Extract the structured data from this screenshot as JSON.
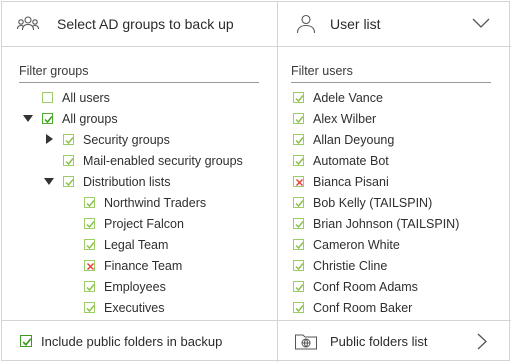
{
  "header": {
    "groups_title": "Select AD groups to back up",
    "users_title": "User list",
    "groups_icon": "group-people-icon",
    "users_icon": "user-icon",
    "dropdown_icon": "chevron-down-icon"
  },
  "groups_panel": {
    "filter_label": "Filter groups",
    "items": [
      {
        "label": "All users",
        "state": "empty",
        "level": 0,
        "arrow": "none"
      },
      {
        "label": "All groups",
        "state": "checked-dark",
        "level": 0,
        "arrow": "down"
      },
      {
        "label": "Security groups",
        "state": "checked",
        "level": 1,
        "arrow": "right"
      },
      {
        "label": "Mail-enabled security groups",
        "state": "checked",
        "level": 1,
        "arrow": "none"
      },
      {
        "label": "Distribution lists",
        "state": "checked",
        "level": 1,
        "arrow": "down"
      },
      {
        "label": "Northwind Traders",
        "state": "checked",
        "level": 2,
        "arrow": "none"
      },
      {
        "label": "Project Falcon",
        "state": "checked",
        "level": 2,
        "arrow": "none"
      },
      {
        "label": "Legal Team",
        "state": "checked",
        "level": 2,
        "arrow": "none"
      },
      {
        "label": "Finance Team",
        "state": "excluded",
        "level": 2,
        "arrow": "none"
      },
      {
        "label": "Employees",
        "state": "checked",
        "level": 2,
        "arrow": "none"
      },
      {
        "label": "Executives",
        "state": "checked",
        "level": 2,
        "arrow": "none"
      }
    ]
  },
  "users_panel": {
    "filter_label": "Filter users",
    "items": [
      {
        "label": "Adele Vance",
        "state": "checked"
      },
      {
        "label": "Alex Wilber",
        "state": "checked"
      },
      {
        "label": "Allan Deyoung",
        "state": "checked"
      },
      {
        "label": "Automate Bot",
        "state": "checked"
      },
      {
        "label": "Bianca Pisani",
        "state": "excluded"
      },
      {
        "label": "Bob Kelly (TAILSPIN)",
        "state": "checked"
      },
      {
        "label": "Brian Johnson (TAILSPIN)",
        "state": "checked"
      },
      {
        "label": "Cameron White",
        "state": "checked"
      },
      {
        "label": "Christie Cline",
        "state": "checked"
      },
      {
        "label": "Conf Room Adams",
        "state": "checked"
      },
      {
        "label": "Conf Room Baker",
        "state": "checked"
      }
    ]
  },
  "footer": {
    "include_public_folders_label": "Include public folders in backup",
    "include_public_folders_checked": true,
    "public_folders_list_label": "Public folders list",
    "public_folders_icon": "globe-folder-icon",
    "next_icon": "chevron-right-icon"
  },
  "colors": {
    "check_light": "#8bc34a",
    "check_dark": "#3d9b1f",
    "exclude": "#e53935",
    "border": "#d4d4d4"
  }
}
